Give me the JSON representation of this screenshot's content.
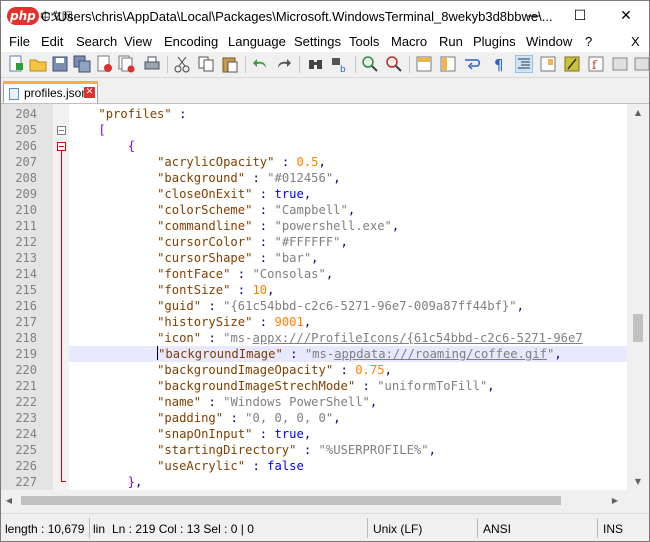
{
  "window": {
    "logo_text": "php",
    "logo_cn": "中文网",
    "title": "C:\\Users\\chris\\AppData\\Local\\Packages\\Microsoft.WindowsTerminal_8wekyb3d8bbwe\\..."
  },
  "menu": [
    "File",
    "Edit",
    "Search",
    "View",
    "Encoding",
    "Language",
    "Settings",
    "Tools",
    "Macro",
    "Run",
    "Plugins",
    "Window",
    "?"
  ],
  "menu_close": "X",
  "tab": {
    "label": "profiles.json"
  },
  "editor": {
    "line_numbers": [
      "204",
      "205",
      "206",
      "207",
      "208",
      "209",
      "210",
      "211",
      "212",
      "213",
      "214",
      "215",
      "216",
      "217",
      "218",
      "219",
      "220",
      "221",
      "222",
      "223",
      "224",
      "225",
      "226",
      "227"
    ],
    "current_line": "219"
  },
  "status": {
    "length": "length : 10,679",
    "lines": "lin",
    "position": "Ln : 219    Col : 13    Sel : 0 | 0",
    "eol": "Unix (LF)",
    "encoding": "ANSI",
    "mode": "INS"
  }
}
